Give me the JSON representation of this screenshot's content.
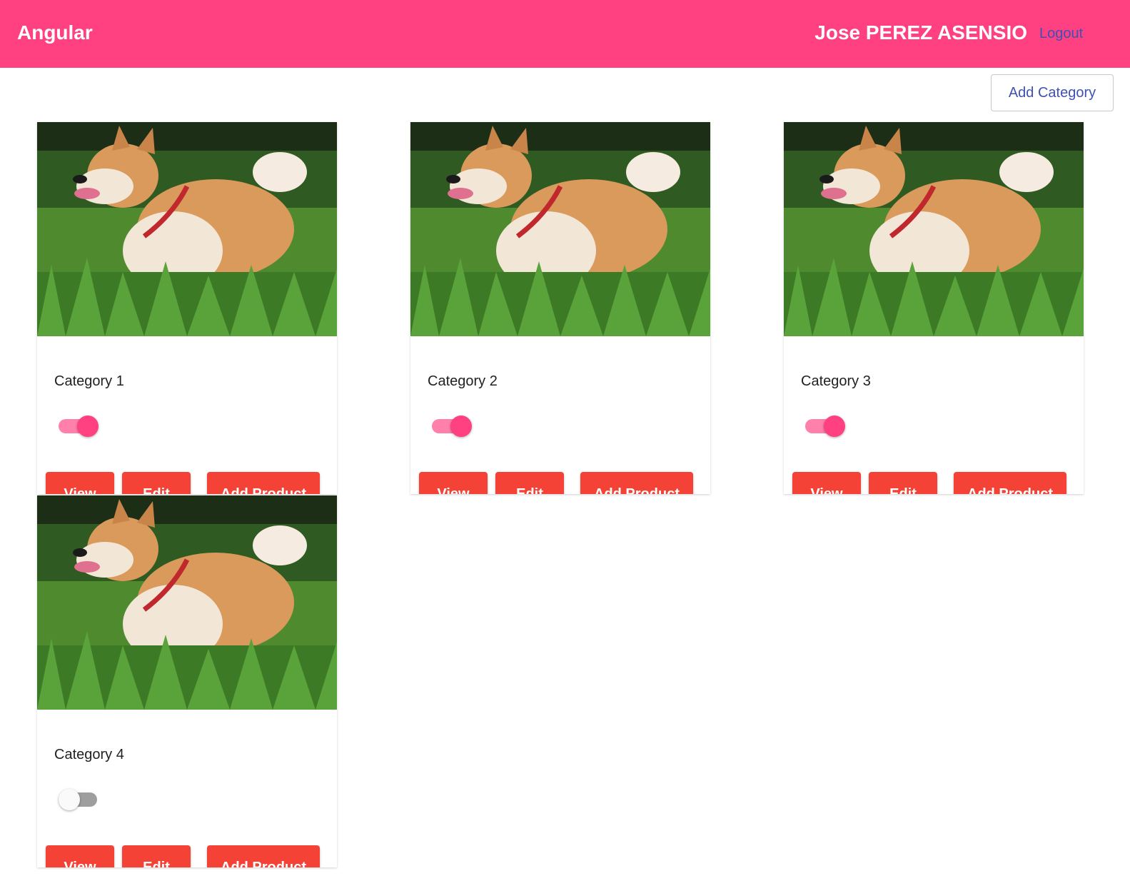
{
  "header": {
    "app_title": "Angular",
    "user_name": "Jose PEREZ ASENSIO",
    "logout_label": "Logout",
    "background_color": "#ff4081",
    "link_color": "#3f51b5"
  },
  "actions": {
    "add_category_label": "Add Category"
  },
  "categories": [
    {
      "name": "Category 1",
      "enabled": true,
      "view_label": "View",
      "edit_label": "Edit",
      "add_product_label": "Add Product"
    },
    {
      "name": "Category 2",
      "enabled": true,
      "view_label": "View",
      "edit_label": "Edit",
      "add_product_label": "Add Product"
    },
    {
      "name": "Category 3",
      "enabled": true,
      "view_label": "View",
      "edit_label": "Edit",
      "add_product_label": "Add Product"
    },
    {
      "name": "Category 4",
      "enabled": false,
      "view_label": "View",
      "edit_label": "Edit",
      "add_product_label": "Add Product"
    }
  ],
  "colors": {
    "button": "#f44336",
    "toggle_on": "#ff4081",
    "toggle_off": "#9e9e9e"
  }
}
